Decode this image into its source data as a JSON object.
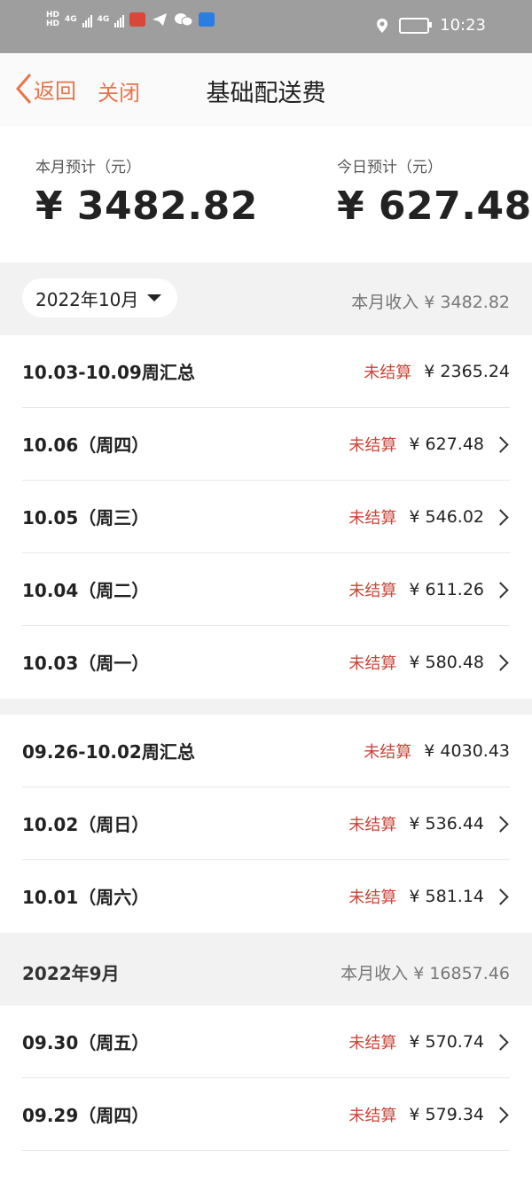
{
  "status_bar": {
    "network_badges": [
      "HD",
      "HD"
    ],
    "net_type_1": "4G",
    "net_type_2": "4G",
    "time": "10:23",
    "icons": [
      "app-delivery-icon",
      "telegram-icon",
      "wechat-icon",
      "lightbulb-app-icon",
      "location-icon",
      "battery-icon"
    ]
  },
  "nav": {
    "back_label": "返回",
    "close_label": "关闭",
    "title": "基础配送费",
    "accent_color": "#e8744a"
  },
  "summary": {
    "month_label": "本月预计（元）",
    "month_value": "¥ 3482.82",
    "today_label": "今日预计（元）",
    "today_value": "¥ 627.48"
  },
  "current_month": {
    "selector": "2022年10月",
    "income_label": "本月收入",
    "income_value": "¥ 3482.82"
  },
  "week1": {
    "summary": {
      "label": "10.03-10.09周汇总",
      "status": "未结算",
      "amount": "¥ 2365.24"
    },
    "days": [
      {
        "label": "10.06（周四）",
        "status": "未结算",
        "amount": "¥ 627.48"
      },
      {
        "label": "10.05（周三）",
        "status": "未结算",
        "amount": "¥ 546.02"
      },
      {
        "label": "10.04（周二）",
        "status": "未结算",
        "amount": "¥ 611.26"
      },
      {
        "label": "10.03（周一）",
        "status": "未结算",
        "amount": "¥ 580.48"
      }
    ]
  },
  "week2": {
    "summary": {
      "label": "09.26-10.02周汇总",
      "status": "未结算",
      "amount": "¥ 4030.43"
    },
    "days": [
      {
        "label": "10.02（周日）",
        "status": "未结算",
        "amount": "¥ 536.44"
      },
      {
        "label": "10.01（周六）",
        "status": "未结算",
        "amount": "¥ 581.14"
      }
    ]
  },
  "prev_month": {
    "title": "2022年9月",
    "income_label": "本月收入",
    "income_value": "¥ 16857.46",
    "days": [
      {
        "label": "09.30（周五）",
        "status": "未结算",
        "amount": "¥ 570.74"
      },
      {
        "label": "09.29（周四）",
        "status": "未结算",
        "amount": "¥ 579.34"
      }
    ]
  },
  "colors": {
    "status_red": "#c8453a",
    "statusbar_gray": "#9e9e9e",
    "section_gray": "#f2f2f2"
  }
}
